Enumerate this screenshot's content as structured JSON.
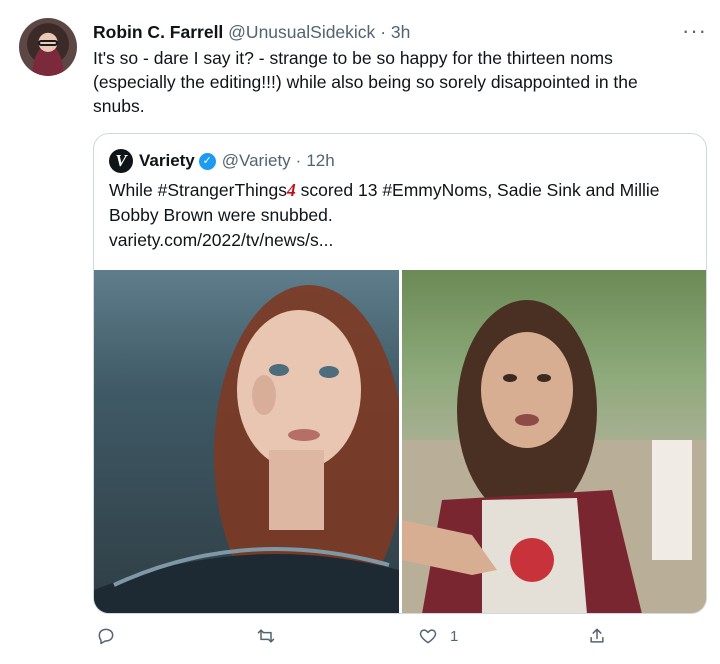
{
  "tweet": {
    "author_name": "Robin C. Farrell",
    "author_handle": "@UnusualSidekick",
    "separator": "·",
    "time": "3h",
    "more": "···",
    "text": "It's so - dare I say it? - strange to be so happy for the thirteen noms (especially the editing!!!) while also being so sorely disappointed in the snubs."
  },
  "quote": {
    "logo_letter": "V",
    "author_name": "Variety",
    "verified": "✓",
    "author_handle": "@Variety",
    "separator": "·",
    "time": "12h",
    "text_part1": "While #StrangerThings",
    "text_badge": "4",
    "text_part2": " scored 13 #EmmyNoms, Sadie Sink and Millie Bobby Brown were snubbed.",
    "link": "variety.com/2022/tv/news/s..."
  },
  "actions": {
    "reply_count": "",
    "retweet_count": "",
    "like_count": "1",
    "share_count": ""
  },
  "colors": {
    "accent": "#1d9bf0",
    "muted": "#536471",
    "border": "#cfd9de"
  }
}
